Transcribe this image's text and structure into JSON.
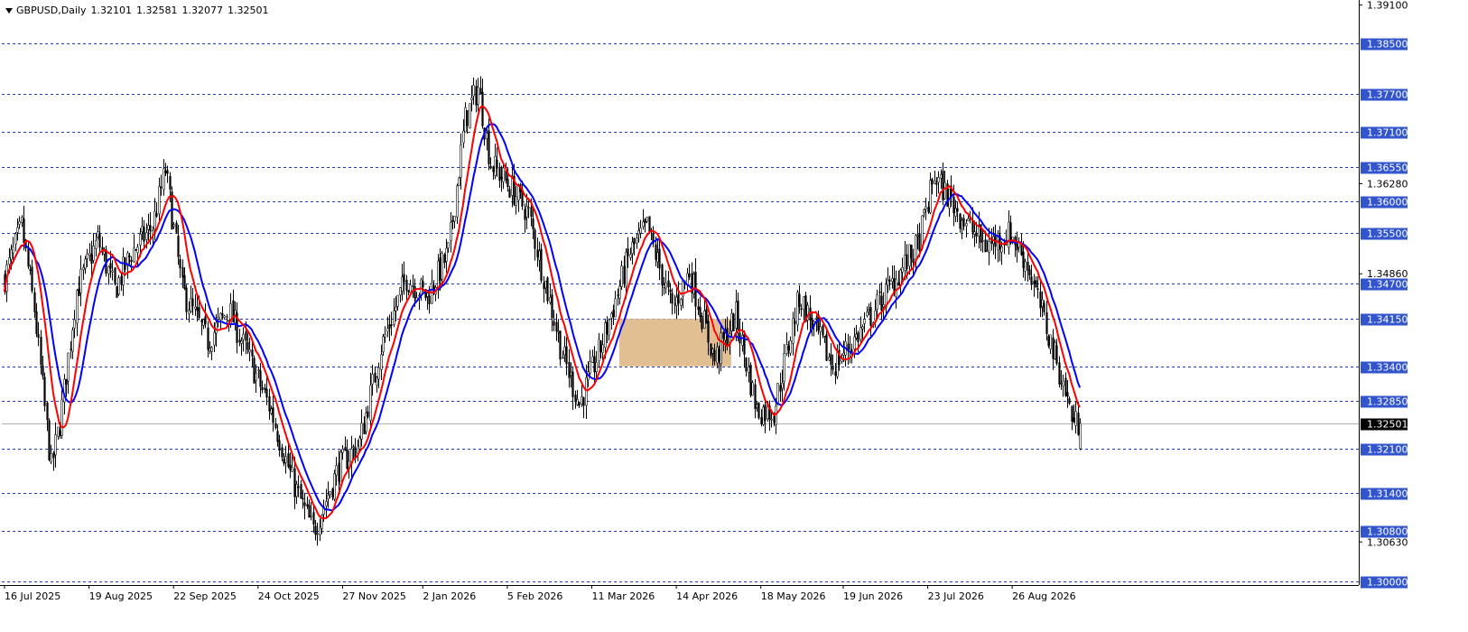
{
  "header": {
    "symbol_timeframe": "GBPUSD,Daily",
    "open": "1.32101",
    "high": "1.32581",
    "low": "1.32077",
    "close": "1.32501"
  },
  "colors": {
    "background": "#ffffff",
    "candle": "#000000",
    "ma_fast": "#ff0000",
    "ma_slow": "#0000ff",
    "level_line": "#1f3fae",
    "level_label_bg": "#3355cc",
    "zone_fill": "#deb887",
    "current_label_bg": "#000000"
  },
  "chart_data": {
    "type": "candlestick",
    "title": "GBPUSD,Daily",
    "y_axis": {
      "min": 1.2995,
      "max": 1.3915,
      "ticks": [
        "1.39100",
        "1.36280",
        "1.34860",
        "1.30630"
      ]
    },
    "x_axis": {
      "labels": [
        "16 Jul 2025",
        "19 Aug 2025",
        "22 Sep 2025",
        "24 Oct 2025",
        "27 Nov 2025",
        "2 Jan 2026",
        "5 Feb 2026",
        "11 Mar 2026",
        "14 Apr 2026",
        "18 May 2026",
        "19 Jun 2026",
        "23 Jul 2026",
        "26 Aug 2026"
      ]
    },
    "levels": [
      "1.38500",
      "1.37700",
      "1.37100",
      "1.36550",
      "1.36000",
      "1.35500",
      "1.34700",
      "1.34150",
      "1.33400",
      "1.32850",
      "1.32100",
      "1.31400",
      "1.30800",
      "1.30000"
    ],
    "current_price": "1.32501",
    "zone": {
      "price_top": 1.3415,
      "price_bottom": 1.334,
      "start_index": 291,
      "end_index": 344
    },
    "close_path": [
      [
        0,
        1.348
      ],
      [
        8,
        1.356
      ],
      [
        14,
        1.343
      ],
      [
        22,
        1.318
      ],
      [
        26,
        1.325
      ],
      [
        34,
        1.346
      ],
      [
        44,
        1.354
      ],
      [
        52,
        1.346
      ],
      [
        60,
        1.352
      ],
      [
        70,
        1.356
      ],
      [
        76,
        1.365
      ],
      [
        84,
        1.346
      ],
      [
        96,
        1.338
      ],
      [
        106,
        1.343
      ],
      [
        116,
        1.335
      ],
      [
        126,
        1.327
      ],
      [
        136,
        1.316
      ],
      [
        146,
        1.308
      ],
      [
        158,
        1.318
      ],
      [
        168,
        1.322
      ],
      [
        178,
        1.337
      ],
      [
        190,
        1.348
      ],
      [
        200,
        1.345
      ],
      [
        210,
        1.352
      ],
      [
        218,
        1.373
      ],
      [
        224,
        1.378
      ],
      [
        230,
        1.366
      ],
      [
        240,
        1.362
      ],
      [
        248,
        1.358
      ],
      [
        256,
        1.347
      ],
      [
        264,
        1.336
      ],
      [
        272,
        1.328
      ],
      [
        282,
        1.337
      ],
      [
        296,
        1.352
      ],
      [
        304,
        1.356
      ],
      [
        316,
        1.343
      ],
      [
        324,
        1.349
      ],
      [
        336,
        1.335
      ],
      [
        346,
        1.342
      ],
      [
        356,
        1.327
      ],
      [
        364,
        1.327
      ],
      [
        376,
        1.345
      ],
      [
        392,
        1.334
      ],
      [
        404,
        1.339
      ],
      [
        420,
        1.347
      ],
      [
        432,
        1.353
      ],
      [
        440,
        1.364
      ],
      [
        452,
        1.358
      ],
      [
        464,
        1.353
      ],
      [
        476,
        1.355
      ],
      [
        484,
        1.35
      ],
      [
        494,
        1.339
      ],
      [
        502,
        1.33
      ],
      [
        506,
        1.325
      ]
    ],
    "series": [
      {
        "values": []
      },
      {
        "values": []
      }
    ]
  }
}
